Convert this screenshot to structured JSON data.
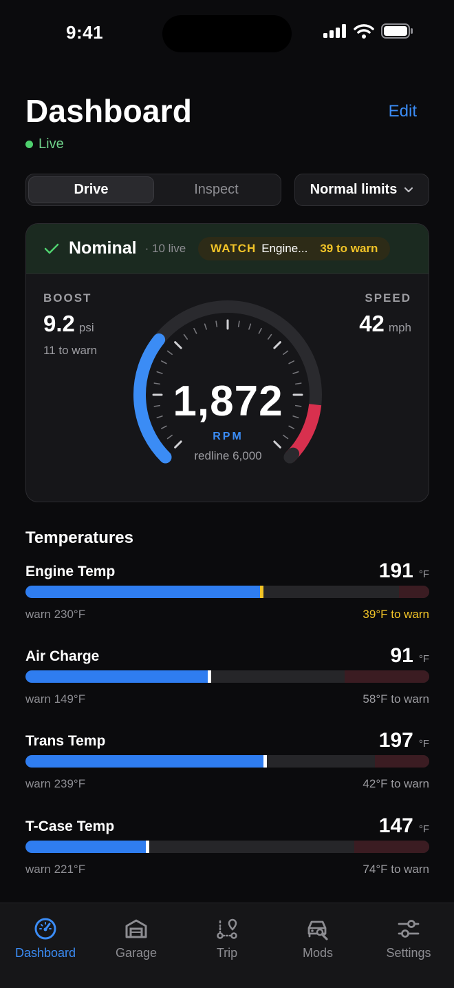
{
  "status": {
    "time": "9:41"
  },
  "header": {
    "title": "Dashboard",
    "edit_label": "Edit",
    "live_label": "Live"
  },
  "segments": [
    {
      "label": "Drive",
      "active": true
    },
    {
      "label": "Inspect",
      "active": false
    }
  ],
  "limits_dropdown": {
    "label": "Normal limits"
  },
  "summary": {
    "status": "Nominal",
    "live_count": "· 10 live",
    "watch_tag": "WATCH",
    "watch_text": "Engine...",
    "watch_warn": "39 to warn"
  },
  "boost": {
    "label": "BOOST",
    "value": "9.2",
    "unit": "psi",
    "sub": "11 to warn"
  },
  "speed": {
    "label": "SPEED",
    "value": "42",
    "unit": "mph"
  },
  "rpm": {
    "value": "1,872",
    "label": "RPM",
    "redline": "redline 6,000",
    "fraction": 0.31,
    "redline_fraction": 0.857
  },
  "temperatures": {
    "title": "Temperatures",
    "items": [
      {
        "name": "Engine Temp",
        "value": "191",
        "unit": "°F",
        "warn": "warn 230°F",
        "remain": "39°F to warn",
        "fill": 0.585,
        "warn_start": 0.925,
        "remain_color": "#f2c428",
        "marker_color": "#f2c428"
      },
      {
        "name": "Air Charge",
        "value": "91",
        "unit": "°F",
        "warn": "warn 149°F",
        "remain": "58°F to warn",
        "fill": 0.455,
        "warn_start": 0.79,
        "remain_color": "#9c9ca1",
        "marker_color": "#ffffff"
      },
      {
        "name": "Trans Temp",
        "value": "197",
        "unit": "°F",
        "warn": "warn 239°F",
        "remain": "42°F to warn",
        "fill": 0.592,
        "warn_start": 0.865,
        "remain_color": "#9c9ca1",
        "marker_color": "#ffffff"
      },
      {
        "name": "T-Case Temp",
        "value": "147",
        "unit": "°F",
        "warn": "warn 221°F",
        "remain": "74°F to warn",
        "fill": 0.302,
        "warn_start": 0.815,
        "remain_color": "#9c9ca1",
        "marker_color": "#ffffff"
      }
    ]
  },
  "tabs": [
    {
      "label": "Dashboard",
      "icon": "gauge-icon",
      "active": true
    },
    {
      "label": "Garage",
      "icon": "garage-icon",
      "active": false
    },
    {
      "label": "Trip",
      "icon": "route-icon",
      "active": false
    },
    {
      "label": "Mods",
      "icon": "car-wrench-icon",
      "active": false
    },
    {
      "label": "Settings",
      "icon": "sliders-icon",
      "active": false
    }
  ],
  "colors": {
    "accent": "#3b8cf5",
    "live": "#4fd06e",
    "warn": "#f2c428",
    "redline": "#d8304e"
  }
}
